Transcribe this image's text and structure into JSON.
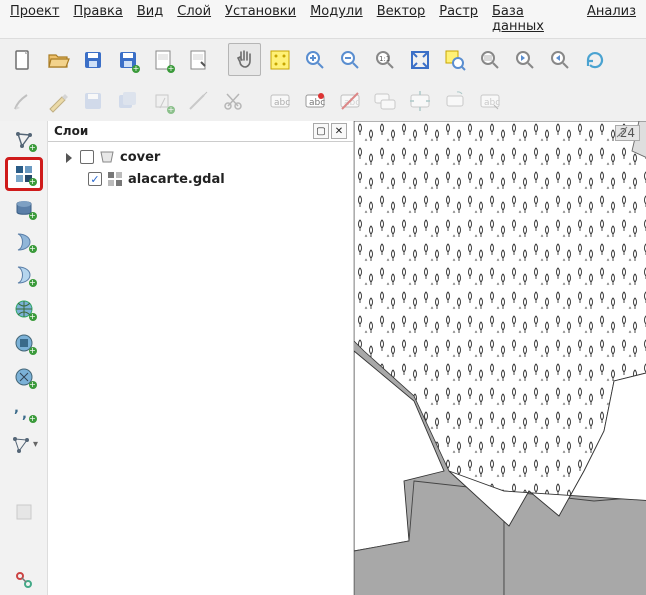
{
  "menu": {
    "project": "Проект",
    "edit": "Правка",
    "view": "Вид",
    "layer": "Слой",
    "settings": "Установки",
    "plugins": "Модули",
    "vector": "Вектор",
    "raster": "Растр",
    "database": "База данных",
    "analysis": "Анализ"
  },
  "layers_panel": {
    "title": "Слои",
    "items": [
      {
        "name": "cover",
        "checked": false,
        "type": "vector"
      },
      {
        "name": "alacarte.gdal",
        "checked": true,
        "type": "raster"
      }
    ]
  },
  "map_status": {
    "scale_badge": "24"
  },
  "toolbar1": [
    "new-project",
    "open-project",
    "save-project",
    "save-as-project",
    "composer-new",
    "composer-manager",
    "sep",
    "pan",
    "pan-selection",
    "zoom-in",
    "zoom-out",
    "zoom-native",
    "zoom-full",
    "zoom-selection",
    "zoom-layer",
    "zoom-last",
    "zoom-next",
    "refresh"
  ],
  "toolbar2": [
    "pencil-brush",
    "pencil",
    "save-edits",
    "save-edits-group",
    "edit-group",
    "edit-tool",
    "scissors",
    "sep",
    "label-abc",
    "label-pin",
    "label-hide",
    "label-all",
    "label-move",
    "label-rotate",
    "label-change"
  ],
  "sidebar": [
    "add-vector",
    "add-raster",
    "add-postgis",
    "add-spatialite",
    "add-mssql",
    "add-oracle",
    "add-wms",
    "add-wfs",
    "add-wcs",
    "add-csv",
    "new-vector",
    "sep",
    "remove-layer",
    "sep",
    "virtual"
  ],
  "colors": {
    "accent": "#cf1b1b",
    "folder": "#dca43a",
    "save": "#3b6fc7",
    "green": "#3a9a3a",
    "gray": "#8a8a8a"
  }
}
